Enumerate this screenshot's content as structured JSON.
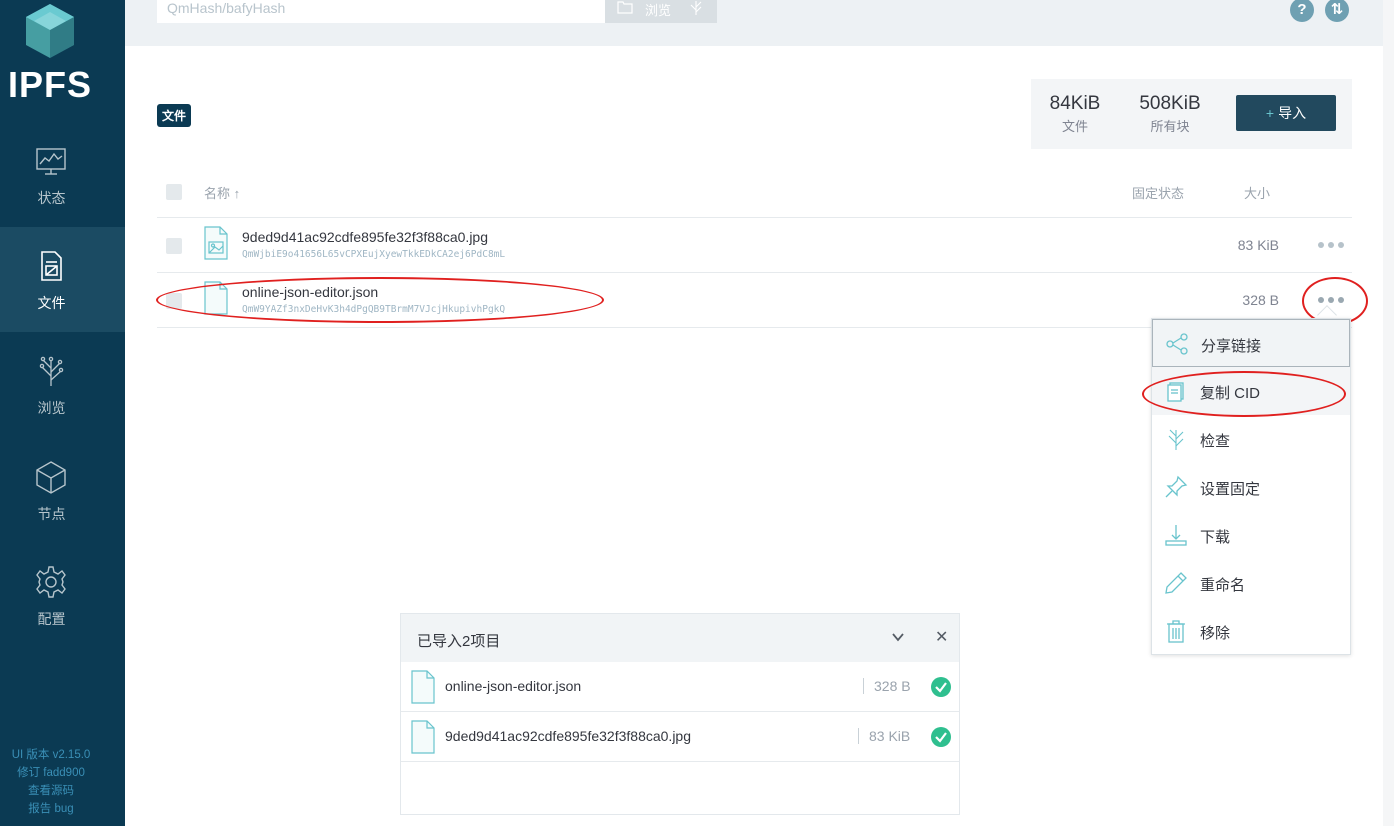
{
  "app": {
    "logo_text": "IPFS"
  },
  "sidebar": {
    "items": [
      {
        "label": "状态",
        "icon": "status-monitor-icon"
      },
      {
        "label": "文件",
        "icon": "files-icon",
        "active": true
      },
      {
        "label": "浏览",
        "icon": "explore-tree-icon"
      },
      {
        "label": "节点",
        "icon": "peers-cube-icon"
      },
      {
        "label": "配置",
        "icon": "settings-gear-icon"
      }
    ],
    "footer": {
      "version": "UI 版本 v2.15.0",
      "revision": "修订 fadd900",
      "source": "查看源码",
      "bug": "报告 bug"
    }
  },
  "header": {
    "search_placeholder": "QmHash/bafyHash",
    "browse_label": "浏览",
    "help_icon": "help-icon",
    "connection_icon": "connection-status-icon"
  },
  "files": {
    "breadcrumb": "文件",
    "stats": {
      "files_size": "84KiB",
      "files_label": "文件",
      "blocks_size": "508KiB",
      "blocks_label": "所有块"
    },
    "import_label": "导入",
    "columns": {
      "name": "名称 ↑",
      "pin": "固定状态",
      "size": "大小"
    },
    "rows": [
      {
        "name": "9ded9d41ac92cdfe895fe32f3f88ca0.jpg",
        "cid": "QmWjbiE9o41656L65vCPXEujXyewTkkEDkCA2ej6PdC8mL",
        "size": "83 KiB"
      },
      {
        "name": "online-json-editor.json",
        "cid": "QmW9YAZf3nxDeHvK3h4dPgQB9TBrmM7VJcjHkupivhPgkQ",
        "size": "328 B"
      }
    ]
  },
  "context_menu": {
    "items": [
      {
        "label": "分享链接",
        "icon": "share-icon"
      },
      {
        "label": "复制 CID",
        "icon": "copy-icon"
      },
      {
        "label": "检查",
        "icon": "inspect-icon"
      },
      {
        "label": "设置固定",
        "icon": "pin-icon"
      },
      {
        "label": "下载",
        "icon": "download-icon"
      },
      {
        "label": "重命名",
        "icon": "rename-icon"
      },
      {
        "label": "移除",
        "icon": "trash-icon"
      }
    ]
  },
  "import_panel": {
    "title": "已导入2项目",
    "items": [
      {
        "name": "online-json-editor.json",
        "size": "328 B"
      },
      {
        "name": "9ded9d41ac92cdfe895fe32f3f88ca0.jpg",
        "size": "83 KiB"
      }
    ]
  },
  "colors": {
    "sidebar_bg": "#0b3a53",
    "accent": "#69c4cd",
    "annotation": "#e0201f",
    "success": "#2fbf8f"
  }
}
